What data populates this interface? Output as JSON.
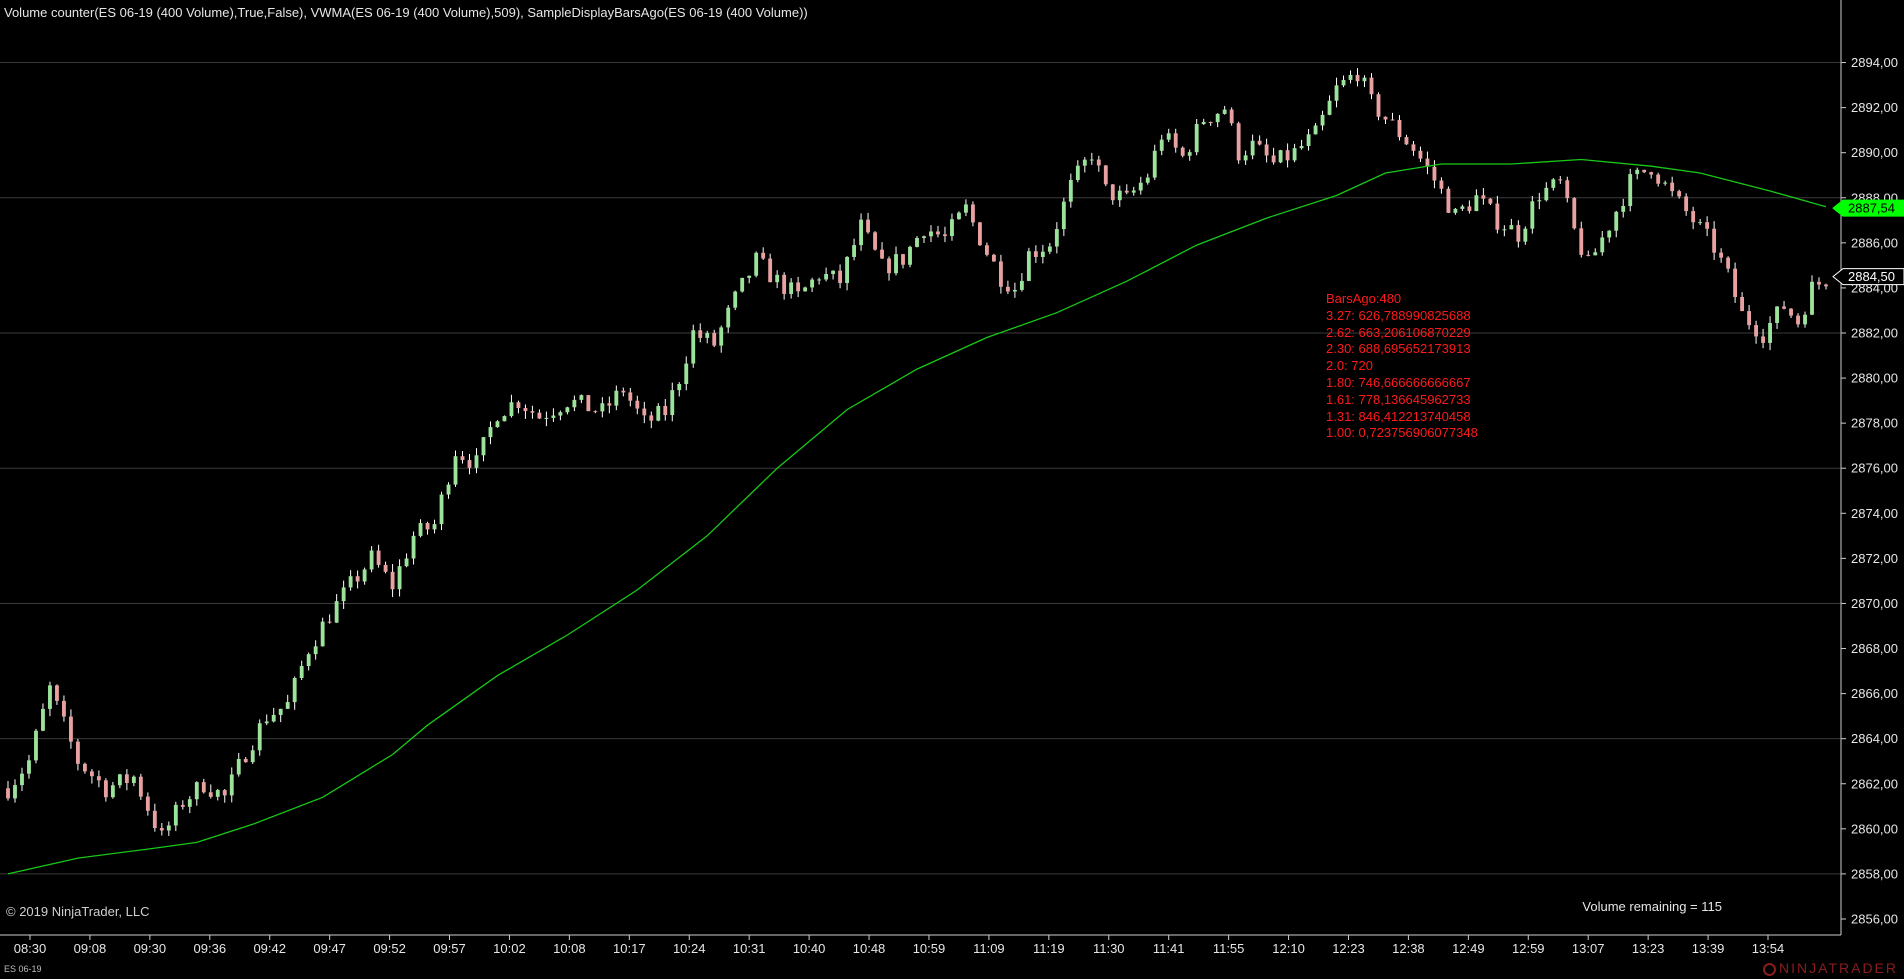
{
  "window": {
    "indicator_line": "Volume counter(ES 06-19 (400 Volume),True,False), VWMA(ES 06-19 (400 Volume),509), SampleDisplayBarsAgo(ES 06-19 (400 Volume))",
    "copyright": "© 2019 NinjaTrader, LLC",
    "volume_remaining": "Volume remaining = 115",
    "instrument": "ES 06-19",
    "brand": "NINJATRADER"
  },
  "annotation": {
    "title": "BarsAgo:480",
    "lines": [
      "3.27: 626,788990825688",
      "2.62: 663,206106870229",
      "2.30: 688,695652173913",
      "2.0: 720",
      "1.80: 746,666666666667",
      "1.61: 778,136645962733",
      "1.31: 846,412213740458",
      "1.00: 0,723756906077348"
    ]
  },
  "colors": {
    "background": "#000000",
    "up_candle": "#9be39b",
    "down_candle": "#e8a0a0",
    "wick": "#ffffff",
    "vwma": "#18c818",
    "annotation": "#ff1a1a",
    "vwma_label": "#00ff00",
    "grid": "#3a3a3a"
  },
  "chart_data": {
    "type": "candlestick",
    "ylim": [
      2855.6,
      2895.0
    ],
    "y_ticks": [
      "2856,00",
      "2858,00",
      "2860,00",
      "2862,00",
      "2864,00",
      "2866,00",
      "2868,00",
      "2870,00",
      "2872,00",
      "2874,00",
      "2876,00",
      "2878,00",
      "2880,00",
      "2882,00",
      "2884,00",
      "2886,00",
      "2888,00",
      "2890,00",
      "2892,00",
      "2894,00"
    ],
    "y_tick_values": [
      2856,
      2858,
      2860,
      2862,
      2864,
      2866,
      2868,
      2870,
      2872,
      2874,
      2876,
      2878,
      2880,
      2882,
      2884,
      2886,
      2888,
      2890,
      2892,
      2894
    ],
    "x_ticks": [
      "08:30",
      "09:08",
      "09:30",
      "09:36",
      "09:42",
      "09:47",
      "09:52",
      "09:57",
      "10:02",
      "10:08",
      "10:17",
      "10:24",
      "10:31",
      "10:40",
      "10:48",
      "10:59",
      "11:09",
      "11:19",
      "11:30",
      "11:41",
      "11:55",
      "12:10",
      "12:23",
      "12:38",
      "12:49",
      "12:59",
      "13:07",
      "13:23",
      "13:39",
      "13:54"
    ],
    "close_path": [
      [
        0,
        2861.8
      ],
      [
        3,
        2863.0
      ],
      [
        6,
        2866.2
      ],
      [
        10,
        2863.0
      ],
      [
        14,
        2861.8
      ],
      [
        18,
        2862.3
      ],
      [
        22,
        2859.6
      ],
      [
        25,
        2861.2
      ],
      [
        28,
        2862.0
      ],
      [
        31,
        2861.4
      ],
      [
        34,
        2863.4
      ],
      [
        37,
        2865.0
      ],
      [
        40,
        2865.5
      ],
      [
        43,
        2868.0
      ],
      [
        46,
        2869.5
      ],
      [
        49,
        2870.8
      ],
      [
        52,
        2872.0
      ],
      [
        55,
        2870.8
      ],
      [
        58,
        2873.0
      ],
      [
        61,
        2873.5
      ],
      [
        64,
        2876.8
      ],
      [
        67,
        2876.2
      ],
      [
        70,
        2878.5
      ],
      [
        73,
        2879.0
      ],
      [
        76,
        2878.3
      ],
      [
        80,
        2879.0
      ],
      [
        85,
        2878.5
      ],
      [
        88,
        2879.5
      ],
      [
        91,
        2878.0
      ],
      [
        94,
        2878.5
      ],
      [
        96,
        2880.0
      ],
      [
        98,
        2882.0
      ],
      [
        101,
        2881.5
      ],
      [
        104,
        2883.5
      ],
      [
        107,
        2885.2
      ],
      [
        110,
        2884.3
      ],
      [
        113,
        2883.6
      ],
      [
        116,
        2884.6
      ],
      [
        119,
        2884.3
      ],
      [
        122,
        2886.7
      ],
      [
        125,
        2884.9
      ],
      [
        128,
        2885.3
      ],
      [
        131,
        2886.7
      ],
      [
        134,
        2886.2
      ],
      [
        137,
        2887.5
      ],
      [
        140,
        2885.6
      ],
      [
        142,
        2884.5
      ],
      [
        144,
        2884.0
      ],
      [
        146,
        2885.5
      ],
      [
        149,
        2886.0
      ],
      [
        152,
        2888.5
      ],
      [
        155,
        2890.0
      ],
      [
        157,
        2888.3
      ],
      [
        160,
        2887.9
      ],
      [
        163,
        2889.0
      ],
      [
        165,
        2890.8
      ],
      [
        168,
        2889.8
      ],
      [
        171,
        2891.5
      ],
      [
        174,
        2892.0
      ],
      [
        176,
        2890.0
      ],
      [
        178,
        2890.3
      ],
      [
        181,
        2889.5
      ],
      [
        184,
        2890.0
      ],
      [
        187,
        2890.8
      ],
      [
        190,
        2892.8
      ],
      [
        193,
        2893.6
      ],
      [
        195,
        2892.2
      ],
      [
        198,
        2891.2
      ],
      [
        201,
        2890.2
      ],
      [
        204,
        2888.8
      ],
      [
        207,
        2887.2
      ],
      [
        210,
        2888.0
      ],
      [
        213,
        2887.0
      ],
      [
        216,
        2886.4
      ],
      [
        219,
        2888.2
      ],
      [
        222,
        2888.6
      ],
      [
        224,
        2886.5
      ],
      [
        226,
        2885.0
      ],
      [
        229,
        2886.8
      ],
      [
        232,
        2888.7
      ],
      [
        235,
        2889.4
      ],
      [
        238,
        2888.1
      ],
      [
        241,
        2887.0
      ],
      [
        244,
        2885.8
      ],
      [
        246,
        2884.5
      ],
      [
        248,
        2882.8
      ],
      [
        251,
        2882.0
      ],
      [
        254,
        2883.2
      ],
      [
        256,
        2882.5
      ],
      [
        258,
        2884.0
      ],
      [
        260,
        2884.4
      ]
    ],
    "vwma_path": [
      [
        0,
        2858.0
      ],
      [
        10,
        2858.7
      ],
      [
        20,
        2859.1
      ],
      [
        27,
        2859.4
      ],
      [
        35,
        2860.2
      ],
      [
        45,
        2861.4
      ],
      [
        55,
        2863.3
      ],
      [
        60,
        2864.6
      ],
      [
        70,
        2866.8
      ],
      [
        80,
        2868.6
      ],
      [
        90,
        2870.6
      ],
      [
        100,
        2873.0
      ],
      [
        110,
        2876.0
      ],
      [
        120,
        2878.6
      ],
      [
        130,
        2880.4
      ],
      [
        140,
        2881.8
      ],
      [
        150,
        2882.9
      ],
      [
        160,
        2884.3
      ],
      [
        170,
        2885.9
      ],
      [
        180,
        2887.1
      ],
      [
        190,
        2888.1
      ],
      [
        197,
        2889.1
      ],
      [
        205,
        2889.5
      ],
      [
        215,
        2889.5
      ],
      [
        225,
        2889.7
      ],
      [
        235,
        2889.4
      ],
      [
        242,
        2889.1
      ],
      [
        252,
        2888.3
      ],
      [
        260,
        2887.6
      ]
    ],
    "bar_count": 260,
    "last_price_label": "2884,50",
    "vwma_label": "2887,54",
    "last_price": 2884.5,
    "vwma_last": 2887.54
  }
}
